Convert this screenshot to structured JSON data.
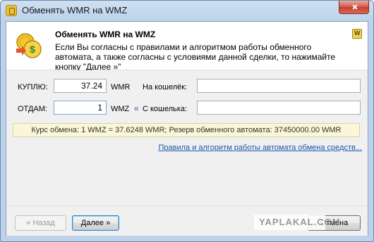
{
  "window": {
    "title": "Обменять WMR на  WMZ"
  },
  "header": {
    "title": "Обменять WMR на  WMZ",
    "text": "Если Вы согласны с правилами и алгоритмом работы обменного автомата, а также согласны с условиями данной сделки, то нажимайте кнопку \"Далее »\""
  },
  "form": {
    "buy_label": "КУПЛЮ:",
    "buy_value": "37.24",
    "buy_currency": "WMR",
    "to_wallet_label": "На кошелёк:",
    "give_label": "ОТДАМ:",
    "give_value": "1",
    "give_currency": "WMZ",
    "swap_arrow": "«",
    "from_wallet_label": "С кошелька:"
  },
  "rate": "Курс обмена: 1 WMZ = 37.6248 WMR; Резерв обменного автомата: 37450000.00 WMR",
  "rules_link": "Правила и алгоритм работы автомата обмена средств...",
  "buttons": {
    "back": "« Назад",
    "next": "Далее »",
    "cancel": "Отмена"
  },
  "watermark": "YAPLAKAL.COM",
  "icons": {
    "app": "webmoney-icon",
    "header": "coins-exchange-icon",
    "help": "webmoney-help-icon",
    "close": "close-icon"
  }
}
